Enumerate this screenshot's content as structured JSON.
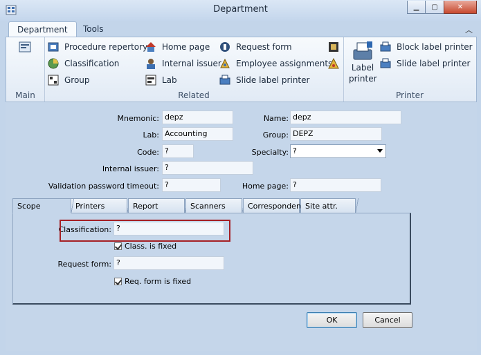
{
  "window": {
    "title": "Department"
  },
  "ribbon": {
    "tabs": [
      "Department",
      "Tools"
    ],
    "groups": {
      "main": {
        "label": "Main"
      },
      "related": {
        "label": "Related",
        "items": [
          "Procedure repertory",
          "Classification",
          "Group",
          "Home page",
          "Internal issuer",
          "Lab",
          "Request form",
          "Employee assignments",
          "Slide label printer"
        ]
      },
      "printer": {
        "label": "Printer",
        "big_button": [
          "Label",
          "printer"
        ],
        "items": [
          "Block label printer",
          "Slide label printer"
        ]
      }
    }
  },
  "form": {
    "mnemonic": {
      "label": "Mnemonic:",
      "value": "depz"
    },
    "name": {
      "label": "Name:",
      "value": "depz"
    },
    "lab": {
      "label": "Lab:",
      "value": "Accounting"
    },
    "group": {
      "label": "Group:",
      "value": "DEPZ"
    },
    "code": {
      "label": "Code:",
      "value": "?"
    },
    "specialty": {
      "label": "Specialty:",
      "value": "?"
    },
    "internal_issuer": {
      "label": "Internal issuer:",
      "value": "?"
    },
    "validation_timeout": {
      "label": "Validation password timeout:",
      "value": "?"
    },
    "home_page": {
      "label": "Home page:",
      "value": "?"
    }
  },
  "inner_tabs": [
    "Scope",
    "Printers",
    "Report builder",
    "Scanners",
    "Correspondent",
    "Site attr."
  ],
  "scope": {
    "classification": {
      "label": "Classification:",
      "value": "?"
    },
    "class_fixed": {
      "label": "Class. is fixed",
      "checked": true
    },
    "request_form": {
      "label": "Request form:",
      "value": "?"
    },
    "req_fixed": {
      "label": "Req. form is fixed",
      "checked": true
    }
  },
  "buttons": {
    "ok": "OK",
    "cancel": "Cancel"
  }
}
